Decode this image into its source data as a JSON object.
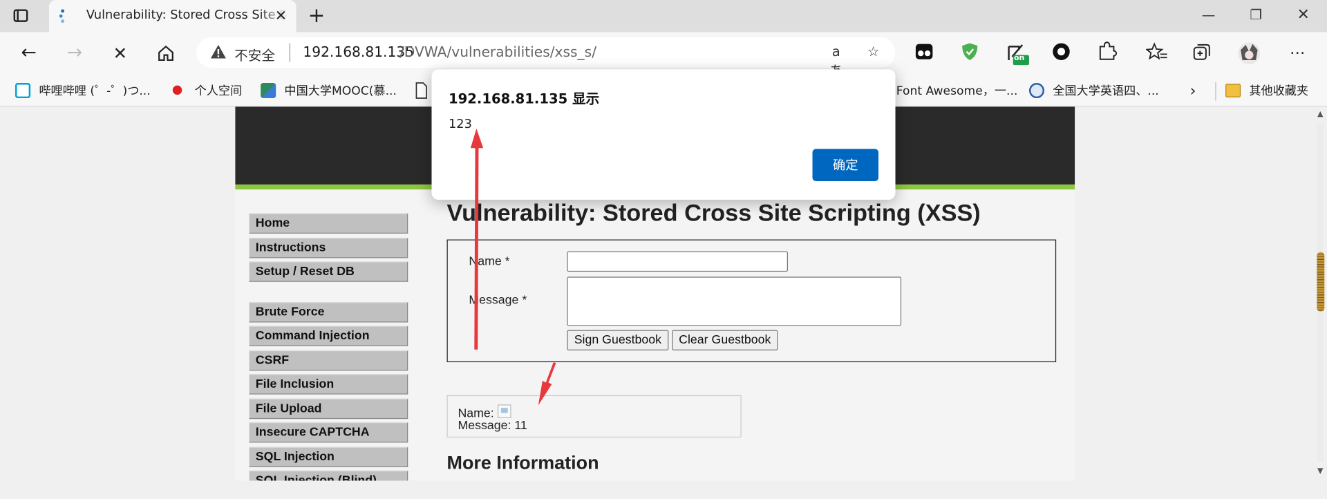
{
  "browser": {
    "tab_title": "Vulnerability: Stored Cross Site Scripting (XSS) :: Damn Vulnerable Web Application (DVWA)",
    "new_tab": "+",
    "url_security": "不安全",
    "url_host": "192.168.81.135",
    "url_path": "/DVWA/vulnerabilities/xss_s/",
    "translate_label": "aあ",
    "extension_badge": "on"
  },
  "bookmarks": [
    {
      "label": "哔哩哔哩 (゜-゜)つ...",
      "icon": "bilibili-icon",
      "color": "#00a1d6"
    },
    {
      "label": "个人空间",
      "icon": "red-dot-icon",
      "color": "#e02020"
    },
    {
      "label": "中国大学MOOC(慕...",
      "icon": "mooc-icon",
      "color": "#2e8b57"
    },
    {
      "label": "Font Awesome，一...",
      "icon": "fontawesome-icon",
      "color": "#339af0"
    },
    {
      "label": "全国大学英语四、...",
      "icon": "cet-icon",
      "color": "#2d5aa8"
    },
    {
      "label": "其他收藏夹",
      "icon": "folder-icon",
      "color": "#f2c040"
    }
  ],
  "dialog": {
    "title": "192.168.81.135 显示",
    "message": "123",
    "ok_label": "确定"
  },
  "dvwa": {
    "menu_top": [
      "Home",
      "Instructions",
      "Setup / Reset DB"
    ],
    "menu_vulns": [
      "Brute Force",
      "Command Injection",
      "CSRF",
      "File Inclusion",
      "File Upload",
      "Insecure CAPTCHA",
      "SQL Injection",
      "SQL Injection (Blind)"
    ],
    "page_title": "Vulnerability: Stored Cross Site Scripting (XSS)",
    "form": {
      "name_label": "Name *",
      "message_label": "Message *",
      "name_value": "",
      "message_value": "",
      "sign_button": "Sign Guestbook",
      "clear_button": "Clear Guestbook"
    },
    "entry": {
      "name_label": "Name:",
      "message_text": "Message: 11"
    },
    "more_info": "More Information"
  },
  "annotations": {
    "arrow_color": "#e8383b"
  }
}
